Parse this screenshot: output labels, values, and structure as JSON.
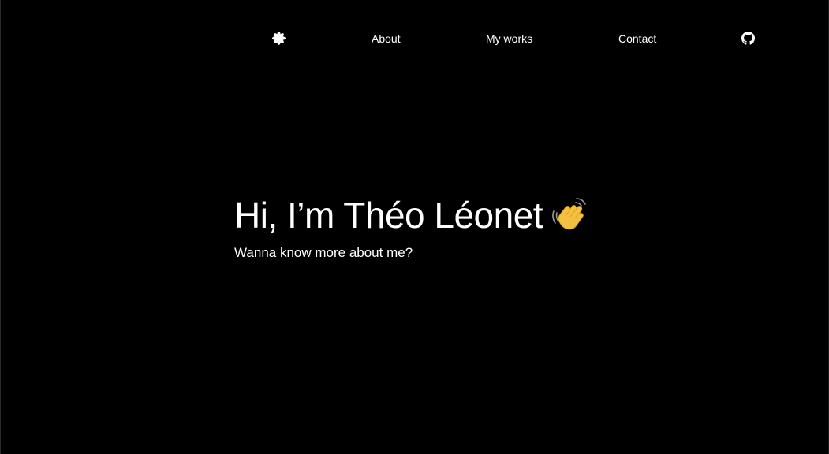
{
  "nav": {
    "logo_icon": "asterisk-flower-icon",
    "links": [
      {
        "label": "About"
      },
      {
        "label": "My works"
      },
      {
        "label": "Contact"
      }
    ],
    "github_icon": "github-icon"
  },
  "hero": {
    "title": "Hi, I’m Théo Léonet",
    "emoji_icon": "waving-hand-icon",
    "cta_label": "Wanna know more about me?"
  },
  "colors": {
    "background": "#000000",
    "text": "#ffffff",
    "emoji": "#f5c542"
  }
}
